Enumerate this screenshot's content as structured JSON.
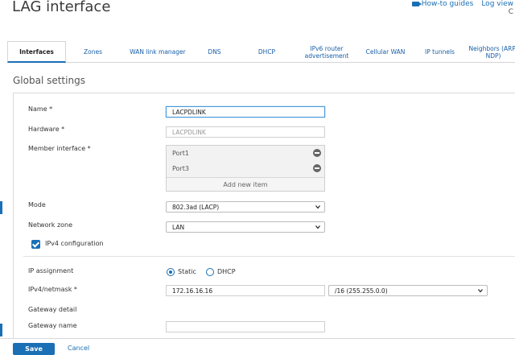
{
  "window": {
    "title": "LAG interface"
  },
  "top_links": {
    "guides": "How-to guides",
    "logs": "Log view",
    "sub": "C"
  },
  "tabs": [
    {
      "label": "Interfaces",
      "active": true
    },
    {
      "label": "Zones"
    },
    {
      "label": "WAN link manager"
    },
    {
      "label": "DNS"
    },
    {
      "label": "DHCP"
    },
    {
      "label": "IPv6 router advertisement"
    },
    {
      "label": "Cellular WAN"
    },
    {
      "label": "IP tunnels"
    },
    {
      "label": "Neighbors (ARP-NDP)"
    }
  ],
  "section": {
    "title": "Global settings"
  },
  "form": {
    "name_label": "Name *",
    "name_value": "LACPDLINK",
    "hardware_label": "Hardware *",
    "hardware_value": "LACPDLINK",
    "member_label": "Member interface *",
    "members": [
      "Port1",
      "Port3"
    ],
    "add_item": "Add new item",
    "mode_label": "Mode",
    "mode_value": "802.3ad (LACP)",
    "zone_label": "Network zone",
    "zone_value": "LAN",
    "ipv4_config_label": "IPv4 configuration",
    "ip_assignment_label": "IP assignment",
    "ip_static": "Static",
    "ip_dhcp": "DHCP",
    "ipv4_label": "IPv4/netmask *",
    "ipv4_value": "172.16.16.16",
    "netmask_value": "/16 (255.255.0.0)",
    "gateway_detail_label": "Gateway detail",
    "gateway_name_label": "Gateway name",
    "gateway_name_value": ""
  },
  "footer": {
    "save": "Save",
    "cancel": "Cancel"
  },
  "colors": {
    "accent": "#1a6fb5"
  }
}
